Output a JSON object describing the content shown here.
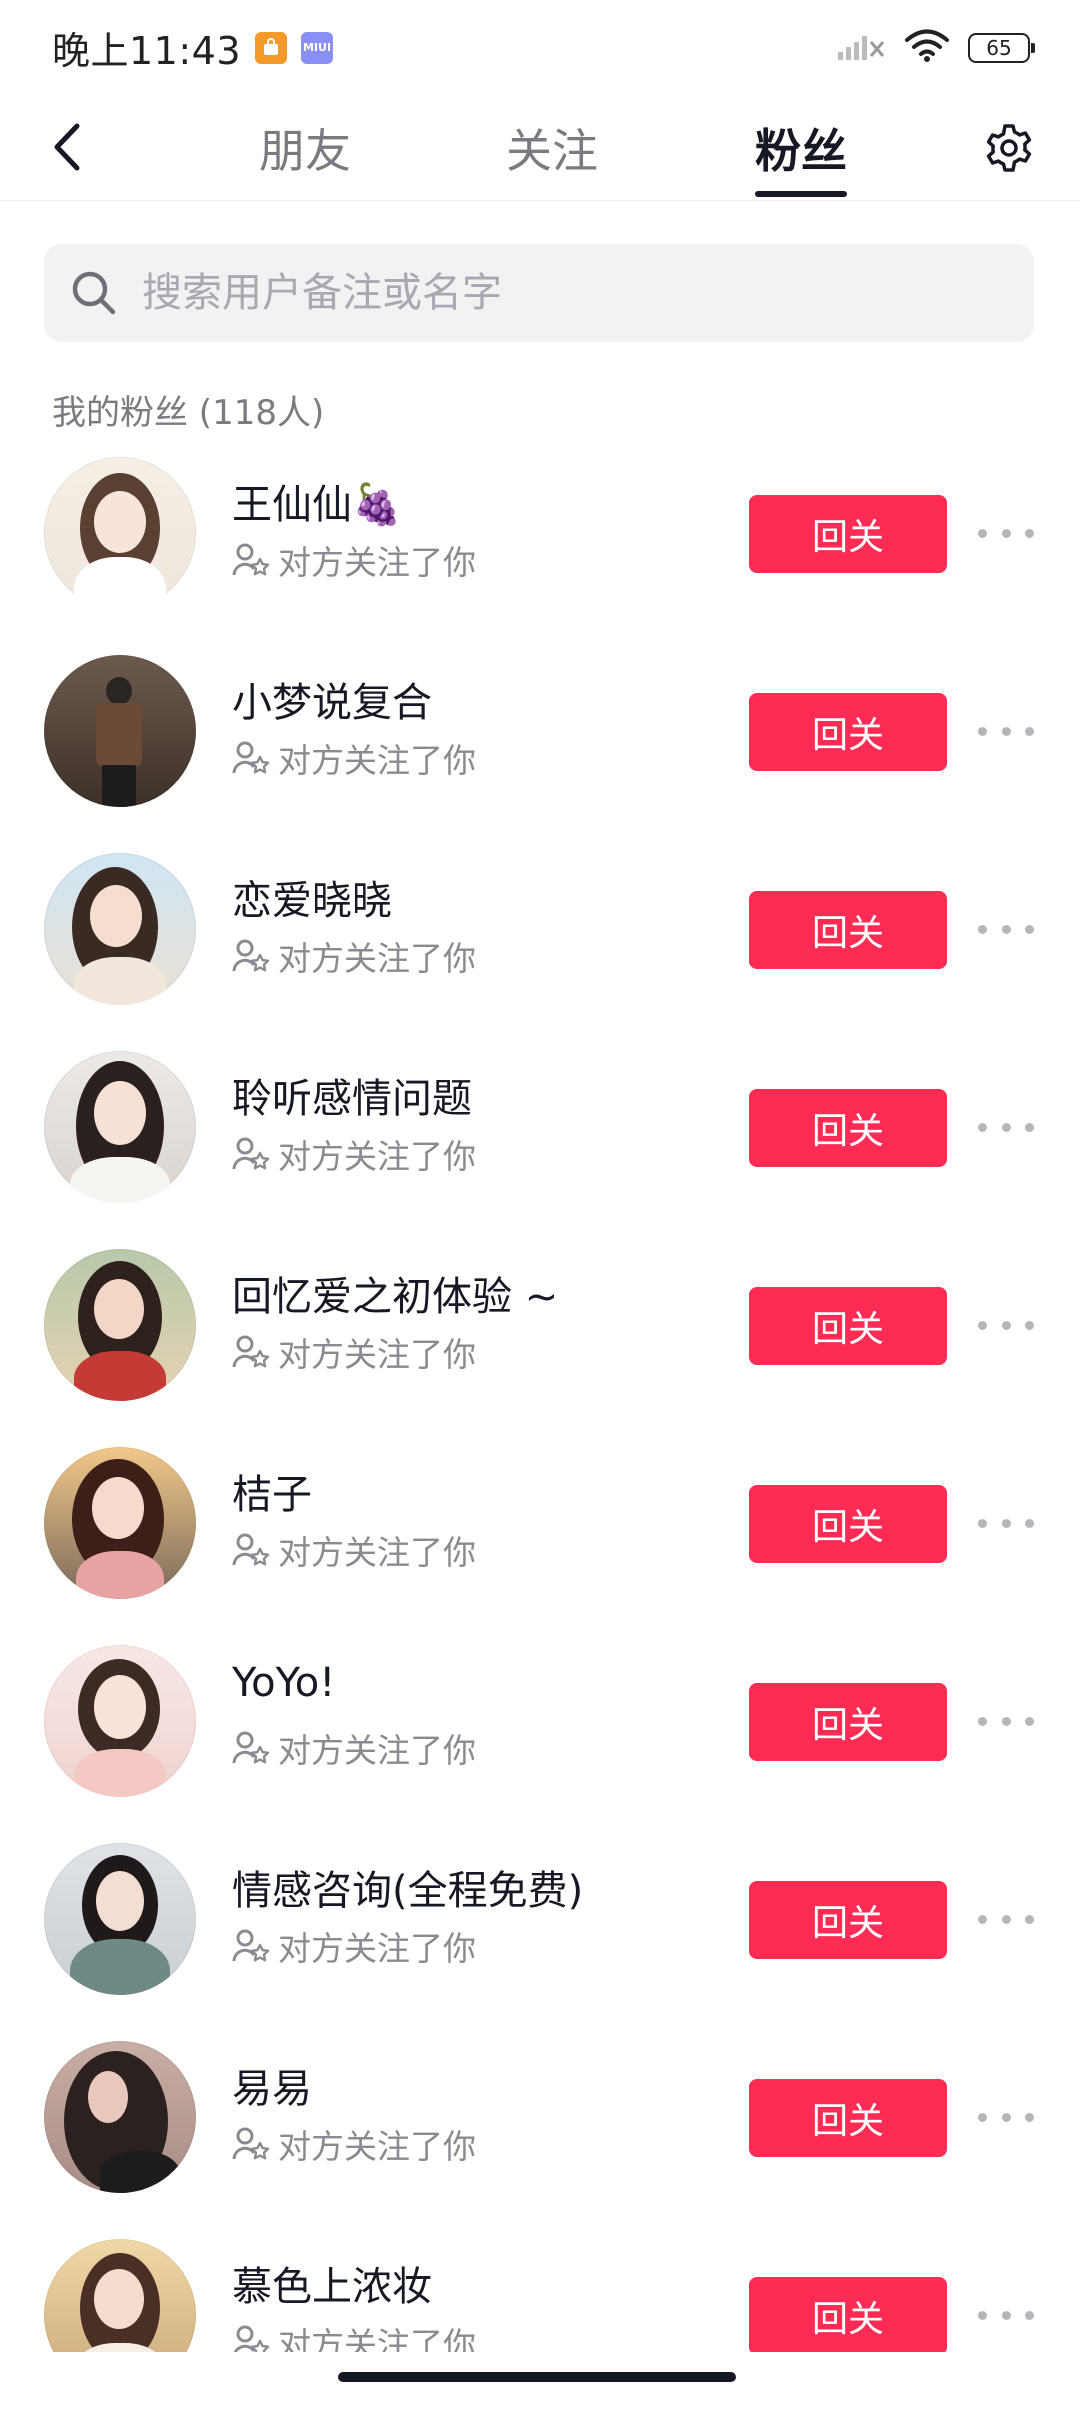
{
  "status_bar": {
    "time": "晚上11:43",
    "badge_miui": "MIUI",
    "battery": "65"
  },
  "nav": {
    "tabs": [
      {
        "label": "朋友"
      },
      {
        "label": "关注"
      },
      {
        "label": "粉丝"
      }
    ],
    "active_tab": "粉丝"
  },
  "search": {
    "placeholder": "搜索用户备注或名字",
    "value": ""
  },
  "section_title": "我的粉丝 (118人)",
  "colors": {
    "accent": "#fe2c55",
    "text_primary": "#161823",
    "text_secondary": "#8a8b90"
  },
  "followers": [
    {
      "name": "王仙仙🍇",
      "status": "对方关注了你",
      "button": "回关"
    },
    {
      "name": "小梦说复合",
      "status": "对方关注了你",
      "button": "回关"
    },
    {
      "name": "恋爱晓晓",
      "status": "对方关注了你",
      "button": "回关"
    },
    {
      "name": "聆听感情问题",
      "status": "对方关注了你",
      "button": "回关"
    },
    {
      "name": "回忆爱之初体验 ~",
      "status": "对方关注了你",
      "button": "回关"
    },
    {
      "name": "桔子",
      "status": "对方关注了你",
      "button": "回关"
    },
    {
      "name": "YoYo!",
      "status": "对方关注了你",
      "button": "回关"
    },
    {
      "name": "情感咨询(全程免费)",
      "status": "对方关注了你",
      "button": "回关"
    },
    {
      "name": "易易",
      "status": "对方关注了你",
      "button": "回关"
    },
    {
      "name": "慕色上浓妆",
      "status": "对方关注了你",
      "button": "回关"
    }
  ]
}
